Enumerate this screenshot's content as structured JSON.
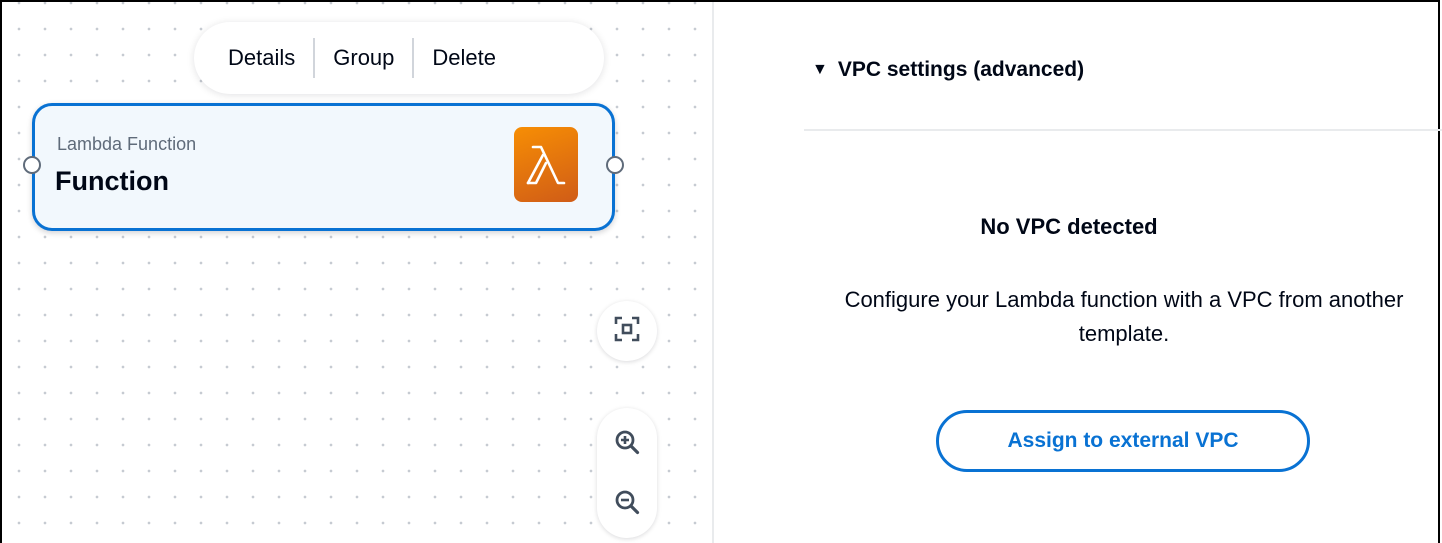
{
  "context_menu": {
    "details_label": "Details",
    "group_label": "Group",
    "delete_label": "Delete"
  },
  "node": {
    "type_label": "Lambda Function",
    "name": "Function",
    "icon": "lambda-icon"
  },
  "canvas_controls": {
    "fit_icon": "fit-to-screen-icon",
    "zoom_in_icon": "zoom-in-icon",
    "zoom_out_icon": "zoom-out-icon"
  },
  "panel": {
    "section_title": "VPC settings (advanced)",
    "caret_glyph": "▼",
    "empty_title": "No VPC detected",
    "empty_description": "Configure your Lambda function with a VPC from another template.",
    "assign_button_label": "Assign to external VPC"
  },
  "colors": {
    "accent": "#0972d3",
    "node_background": "#f2f8fd",
    "lambda_orange": "#e7690f",
    "text_primary": "#000716",
    "text_secondary": "#5f6b7a"
  }
}
